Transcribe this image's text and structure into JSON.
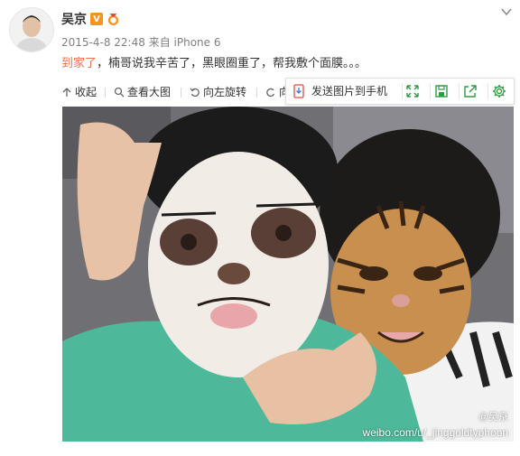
{
  "post": {
    "user_name": "吴京",
    "verified_badge": "V",
    "timestamp": "2015-4-8 22:48",
    "source": "来自 iPhone 6",
    "text_link": "到家了",
    "text_body": "，楠哥说我辛苦了，黑眼圈重了，帮我敷个面膜。。。"
  },
  "toolbar": {
    "collapse": "收起",
    "view_large": "查看大图",
    "rotate_left": "向左旋转",
    "rotate_right_partial": "向"
  },
  "send_to_phone": {
    "label": "发送图片到手机"
  },
  "photo": {
    "watermark": "weibo.com/u/_jinggoldtyphoon",
    "handle": "@吴京"
  },
  "colors": {
    "link": "#eb7350",
    "badge": "#f7931e",
    "icon_green": "#2e9b3f"
  },
  "icons": [
    "avatar",
    "v-badge",
    "medal-icon",
    "chevron-down-icon",
    "collapse-icon",
    "zoom-icon",
    "rotate-left-icon",
    "rotate-right-icon",
    "send-to-phone-icon",
    "expand-icon",
    "save-icon",
    "share-icon",
    "gear-icon"
  ]
}
